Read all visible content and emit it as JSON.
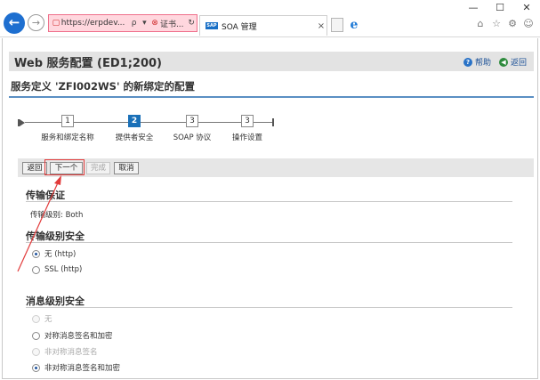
{
  "browser": {
    "window_buttons": [
      "—",
      "☐",
      "✕"
    ],
    "address": {
      "url": "https://erpdev...",
      "search_glyph": "ρ",
      "dropdown_glyph": "▾",
      "cert_label": "证书...",
      "refresh_glyph": "↻"
    },
    "tab": {
      "badge": "SAP",
      "title": "SOA 管理",
      "close": "×"
    },
    "right_tools": [
      "⌂",
      "☆",
      "⚙",
      "☺"
    ]
  },
  "page": {
    "title": "Web 服务配置 (ED1;200)",
    "help_label": "帮助",
    "back_label": "返回",
    "subtitle": "服务定义 'ZFI002WS' 的新绑定的配置"
  },
  "roadmap": {
    "steps": [
      {
        "number": "1",
        "label": "服务和绑定名称",
        "active": false
      },
      {
        "number": "2",
        "label": "提供者安全",
        "active": true
      },
      {
        "number": "3",
        "label": "SOAP 协议",
        "active": false
      },
      {
        "number": "3",
        "label": "操作设置",
        "active": false
      }
    ]
  },
  "toolbar": {
    "back": "返回",
    "next": "下一个",
    "finish": "完成",
    "cancel": "取消"
  },
  "transport_guarantee": {
    "title": "传输保证",
    "level_label": "传输级别:",
    "level_value": "Both"
  },
  "transport_security": {
    "title": "传输级别安全",
    "options": [
      {
        "label": "无 (http)",
        "selected": true,
        "disabled": false
      },
      {
        "label": "SSL (http)",
        "selected": false,
        "disabled": false
      }
    ]
  },
  "message_security": {
    "title": "消息级别安全",
    "options": [
      {
        "label": "无",
        "selected": false,
        "disabled": true
      },
      {
        "label": "对称消息签名和加密",
        "selected": false,
        "disabled": false
      },
      {
        "label": "非对称消息签名",
        "selected": false,
        "disabled": true
      },
      {
        "label": "非对称消息签名和加密",
        "selected": true,
        "disabled": false
      }
    ]
  },
  "colors": {
    "accent": "#1a70b8",
    "annotation": "#e23b3b"
  }
}
